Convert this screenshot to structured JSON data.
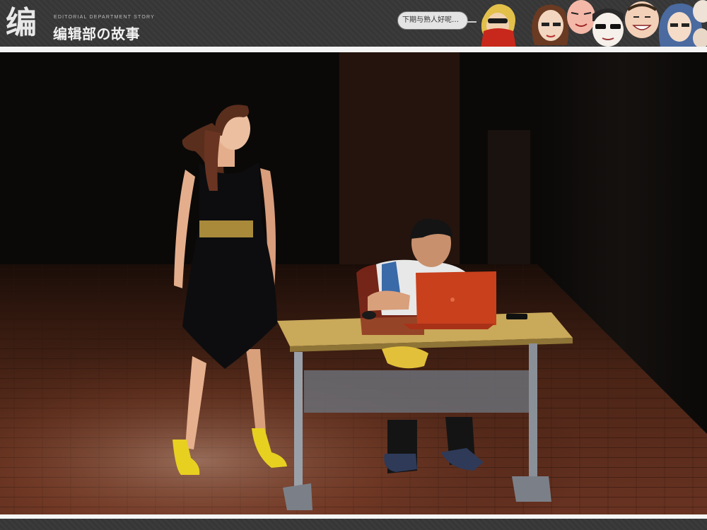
{
  "header": {
    "logo_mark": "编",
    "logo_subtitle": "EDITORIAL DEPARTMENT STORY",
    "logo_title": "编辑部の故事",
    "speech_bubble": "下期与熟人好呢…",
    "cast_faces": [
      "blond-masked-character",
      "brown-haired-woman",
      "pink-faced-man",
      "bald-sunglasses-man",
      "smiling-man",
      "blue-haired-woman"
    ]
  },
  "photo": {
    "scene": "stage",
    "colors": {
      "floor": "#5a2a1a",
      "desk_top": "#c9a95a",
      "laptop": "#c8401c",
      "heels": "#e8d020",
      "dress": "#0d0d0f",
      "belt": "#a88a3a"
    }
  },
  "colors": {
    "header_bg": "#3a3a3a",
    "rule": "#f5f5f5"
  }
}
